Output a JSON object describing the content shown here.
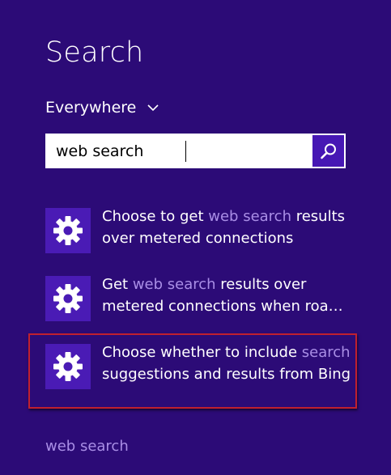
{
  "header": {
    "title": "Search"
  },
  "scope": {
    "label": "Everywhere",
    "icon": "chevron-down-icon"
  },
  "search": {
    "value": "web search",
    "button_icon": "search-icon"
  },
  "results": [
    {
      "pre": "Choose to get ",
      "hl": "web search",
      "post": " results",
      "line2": "over metered connections",
      "icon": "gear-icon"
    },
    {
      "pre": "Get ",
      "hl": "web search",
      "post": " results over",
      "line2": "metered connections when roa…",
      "icon": "gear-icon"
    },
    {
      "pre": "Choose whether to include ",
      "hl": "search",
      "post": "",
      "line2": "suggestions and results from Bing",
      "icon": "gear-icon"
    }
  ],
  "suggestion": {
    "label": "web search"
  },
  "colors": {
    "background": "#2c0b77",
    "tile": "#4a1bb5",
    "highlight_text": "#a98ee6",
    "selection_border": "#c0202f"
  }
}
